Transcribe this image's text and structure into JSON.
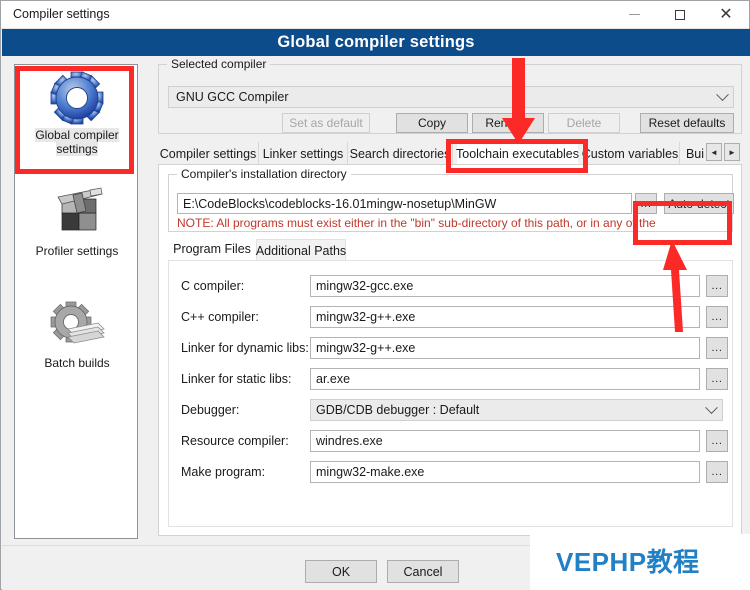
{
  "window": {
    "title": "Compiler settings",
    "controls": {
      "minimize": "minimize-icon",
      "maximize": "maximize-icon",
      "close": "close-icon"
    }
  },
  "header": {
    "title": "Global compiler settings",
    "bg_color": "#0d4c8b"
  },
  "sidebar": {
    "items": [
      {
        "label": "Global compiler settings",
        "icon": "gear-blue-icon",
        "selected": true
      },
      {
        "label": "Profiler settings",
        "icon": "caliper-icon",
        "selected": false
      },
      {
        "label": "Batch builds",
        "icon": "gear-stack-icon",
        "selected": false
      }
    ]
  },
  "selected_compiler": {
    "group_title": "Selected compiler",
    "combo_value": "GNU GCC Compiler",
    "buttons": [
      {
        "label": "Set as default",
        "enabled": false
      },
      {
        "label": "Copy",
        "enabled": true
      },
      {
        "label": "Rename",
        "enabled": true
      },
      {
        "label": "Delete",
        "enabled": false
      },
      {
        "label": "Reset defaults",
        "enabled": true
      }
    ]
  },
  "tabs": {
    "items": [
      {
        "label": "Compiler settings",
        "active": false
      },
      {
        "label": "Linker settings",
        "active": false
      },
      {
        "label": "Search directories",
        "active": false
      },
      {
        "label": "Toolchain executables",
        "active": true
      },
      {
        "label": "Custom variables",
        "active": false
      },
      {
        "label": "Bui",
        "active": false
      }
    ],
    "scroll_left": "◄",
    "scroll_right": "►"
  },
  "install_dir": {
    "group_title": "Compiler's installation directory",
    "path_value": "E:\\CodeBlocks\\codeblocks-16.01mingw-nosetup\\MinGW",
    "browse_label": "...",
    "autodetect_label": "Auto-detect",
    "note": "NOTE: All programs must exist either in the \"bin\" sub-directory of this path, or in any of the",
    "note_color": "#c0392b"
  },
  "inner_tabs": {
    "items": [
      {
        "label": "Program Files",
        "active": true
      },
      {
        "label": "Additional Paths",
        "active": false
      }
    ]
  },
  "program_files": {
    "browse_label": "...",
    "rows": [
      {
        "label": "C compiler:",
        "value": "mingw32-gcc.exe",
        "type": "text"
      },
      {
        "label": "C++ compiler:",
        "value": "mingw32-g++.exe",
        "type": "text"
      },
      {
        "label": "Linker for dynamic libs:",
        "value": "mingw32-g++.exe",
        "type": "text"
      },
      {
        "label": "Linker for static libs:",
        "value": "ar.exe",
        "type": "text"
      },
      {
        "label": "Debugger:",
        "value": "GDB/CDB debugger : Default",
        "type": "combo"
      },
      {
        "label": "Resource compiler:",
        "value": "windres.exe",
        "type": "text"
      },
      {
        "label": "Make program:",
        "value": "mingw32-make.exe",
        "type": "text"
      }
    ]
  },
  "footer": {
    "ok_label": "OK",
    "cancel_label": "Cancel"
  },
  "watermark": {
    "text": "VEPHP教程",
    "color": "#2181c4"
  },
  "annotations": {
    "highlight_color": "#fb2a26",
    "boxes": [
      {
        "target": "sidebar-item-global-compiler-settings"
      },
      {
        "target": "tab-toolchain-executables"
      },
      {
        "target": "auto-detect-button"
      }
    ],
    "arrows": [
      {
        "direction": "down",
        "from": "top-toolbar",
        "to": "tab-toolchain-executables"
      },
      {
        "direction": "up",
        "from": "program-files-area",
        "to": "auto-detect-button"
      }
    ]
  }
}
